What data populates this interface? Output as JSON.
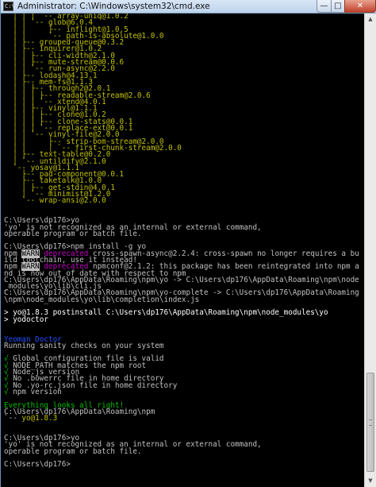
{
  "window": {
    "title": "Administrator: C:\\Windows\\system32\\cmd.exe",
    "icon_label": "C:\\",
    "minimize_glyph": "—",
    "maximize_glyph": "□",
    "close_glyph": "✕"
  },
  "colors": {
    "default": "#c0c0c0",
    "yellow": "#c0c000",
    "white": "#ffffff",
    "blue": "#2050ff",
    "green": "#00c000",
    "warn_bg": "#c0c0c0",
    "warn_fg": "#000000",
    "magenta": "#c000c0"
  },
  "console": {
    "lines": [
      [
        {
          "t": "  │ │ │ `-- ",
          "c": "yellow"
        },
        {
          "t": "array-uniq@1.0.2",
          "c": "yellow"
        }
      ],
      [
        {
          "t": "  │ │ `-- glob@6.0.4",
          "c": "yellow"
        }
      ],
      [
        {
          "t": "  │ │     ├-- inflight@1.0.5",
          "c": "yellow"
        }
      ],
      [
        {
          "t": "  │ │     `-- path-is-absolute@1.0.0",
          "c": "yellow"
        }
      ],
      [
        {
          "t": "  │ ├-- grouped-queue@0.3.2",
          "c": "yellow"
        }
      ],
      [
        {
          "t": "  │ ├-- inquirer@1.0.2",
          "c": "yellow"
        }
      ],
      [
        {
          "t": "  │ │ ├-- cli-width@2.1.0",
          "c": "yellow"
        }
      ],
      [
        {
          "t": "  │ │ ├-- mute-stream@0.0.6",
          "c": "yellow"
        }
      ],
      [
        {
          "t": "  │ │ `-- run-async@2.2.0",
          "c": "yellow"
        }
      ],
      [
        {
          "t": "  │ ├-- lodash@4.13.1",
          "c": "yellow"
        }
      ],
      [
        {
          "t": "  │ ├-- mem-fs@1.1.3",
          "c": "yellow"
        }
      ],
      [
        {
          "t": "  │ │ ├-- through2@2.0.1",
          "c": "yellow"
        }
      ],
      [
        {
          "t": "  │ │ │ ├-- readable-stream@2.0.6",
          "c": "yellow"
        }
      ],
      [
        {
          "t": "  │ │ │ `-- xtend@4.0.1",
          "c": "yellow"
        }
      ],
      [
        {
          "t": "  │ │ ├-- vinyl@1.1.1",
          "c": "yellow"
        }
      ],
      [
        {
          "t": "  │ │ │ ├-- clone@1.0.2",
          "c": "yellow"
        }
      ],
      [
        {
          "t": "  │ │ │ ├-- clone-stats@0.0.1",
          "c": "yellow"
        }
      ],
      [
        {
          "t": "  │ │ │ `-- replace-ext@0.0.1",
          "c": "yellow"
        }
      ],
      [
        {
          "t": "  │ │ `-- vinyl-file@2.0.0",
          "c": "yellow"
        }
      ],
      [
        {
          "t": "  │ │     ├-- strip-bom-stream@2.0.0",
          "c": "yellow"
        }
      ],
      [
        {
          "t": "  │ │     │ `-- first-chunk-stream@2.0.0",
          "c": "yellow"
        }
      ],
      [
        {
          "t": "  │ ├-- text-table@0.2.0",
          "c": "yellow"
        }
      ],
      [
        {
          "t": "  │ `-- untildify@2.1.0",
          "c": "yellow"
        }
      ],
      [
        {
          "t": "  `-- yosay@1.1.1",
          "c": "yellow"
        }
      ],
      [
        {
          "t": "    ├-- pad-component@0.0.1",
          "c": "yellow"
        }
      ],
      [
        {
          "t": "    ├-- taketalk@1.0.0",
          "c": "yellow"
        }
      ],
      [
        {
          "t": "    │ ├-- get-stdin@4.0.1",
          "c": "yellow"
        }
      ],
      [
        {
          "t": "    │ `-- minimist@1.2.0",
          "c": "yellow"
        }
      ],
      [
        {
          "t": "    `-- wrap-ansi@2.0.0",
          "c": "yellow"
        }
      ],
      [
        {
          "t": " ",
          "c": "default"
        }
      ],
      [
        {
          "t": " ",
          "c": "default"
        }
      ],
      [
        {
          "t": "C:\\Users\\dp176>yo",
          "c": "default"
        }
      ],
      [
        {
          "t": "'yo' is not recognized as an internal or external command,",
          "c": "default"
        }
      ],
      [
        {
          "t": "operable program or batch file.",
          "c": "default"
        }
      ],
      [
        {
          "t": " ",
          "c": "default"
        }
      ],
      [
        {
          "t": "C:\\Users\\dp176>npm install -g yo",
          "c": "default"
        }
      ],
      [
        {
          "t": "npm ",
          "c": "default"
        },
        {
          "t": "WARN",
          "c": "warn"
        },
        {
          "t": " ",
          "c": "default"
        },
        {
          "t": "deprecated",
          "c": "magenta"
        },
        {
          "t": " cross-spawn-async@2.2.4: cross-spawn no longer requires a bu",
          "c": "default"
        }
      ],
      [
        {
          "t": "ild toolchain, use it instead!",
          "c": "default"
        }
      ],
      [
        {
          "t": "npm ",
          "c": "default"
        },
        {
          "t": "WARN",
          "c": "warn"
        },
        {
          "t": " ",
          "c": "default"
        },
        {
          "t": "deprecated",
          "c": "magenta"
        },
        {
          "t": " npmconf@2.1.2: this package has been reintegrated into npm a",
          "c": "default"
        }
      ],
      [
        {
          "t": "nd is now out of date with respect to npm",
          "c": "default"
        }
      ],
      [
        {
          "t": "C:\\Users\\dp176\\AppData\\Roaming\\npm\\yo -> C:\\Users\\dp176\\AppData\\Roaming\\npm\\node",
          "c": "default"
        }
      ],
      [
        {
          "t": "_modules\\yo\\lib\\cli.js",
          "c": "default"
        }
      ],
      [
        {
          "t": "C:\\Users\\dp176\\AppData\\Roaming\\npm\\yo-complete -> C:\\Users\\dp176\\AppData\\Roaming",
          "c": "default"
        }
      ],
      [
        {
          "t": "\\npm\\node_modules\\yo\\lib\\completion\\index.js",
          "c": "default"
        }
      ],
      [
        {
          "t": " ",
          "c": "default"
        }
      ],
      [
        {
          "t": "> yo@1.8.3 postinstall C:\\Users\\dp176\\AppData\\Roaming\\npm\\node_modules\\yo",
          "c": "white"
        }
      ],
      [
        {
          "t": "> yodoctor",
          "c": "white"
        }
      ],
      [
        {
          "t": " ",
          "c": "default"
        }
      ],
      [
        {
          "t": " ",
          "c": "default"
        }
      ],
      [
        {
          "t": "Yeoman Doctor",
          "c": "blue"
        }
      ],
      [
        {
          "t": "Running sanity checks on your system",
          "c": "default"
        }
      ],
      [
        {
          "t": " ",
          "c": "default"
        }
      ],
      [
        {
          "t": "√",
          "c": "green"
        },
        {
          "t": " Global configuration file is valid",
          "c": "default"
        }
      ],
      [
        {
          "t": "√",
          "c": "green"
        },
        {
          "t": " NODE_PATH matches the npm root",
          "c": "default"
        }
      ],
      [
        {
          "t": "√",
          "c": "green"
        },
        {
          "t": " Node.js version",
          "c": "default"
        }
      ],
      [
        {
          "t": "√",
          "c": "green"
        },
        {
          "t": " No .bowerrc file in home directory",
          "c": "default"
        }
      ],
      [
        {
          "t": "√",
          "c": "green"
        },
        {
          "t": " No .yo-rc.json file in home directory",
          "c": "default"
        }
      ],
      [
        {
          "t": "√",
          "c": "green"
        },
        {
          "t": " npm version",
          "c": "default"
        }
      ],
      [
        {
          "t": " ",
          "c": "default"
        }
      ],
      [
        {
          "t": "Everything looks all right!",
          "c": "green"
        }
      ],
      [
        {
          "t": "C:\\Users\\dp176\\AppData\\Roaming\\npm",
          "c": "default"
        }
      ],
      [
        {
          "t": "`-- ",
          "c": "default"
        },
        {
          "t": "yo@1.8.3",
          "c": "yellow"
        }
      ],
      [
        {
          "t": " ",
          "c": "default"
        }
      ],
      [
        {
          "t": " ",
          "c": "default"
        }
      ],
      [
        {
          "t": "C:\\Users\\dp176>yo",
          "c": "default"
        }
      ],
      [
        {
          "t": "'yo' is not recognized as an internal or external command,",
          "c": "default"
        }
      ],
      [
        {
          "t": "operable program or batch file.",
          "c": "default"
        }
      ],
      [
        {
          "t": " ",
          "c": "default"
        }
      ],
      [
        {
          "t": "C:\\Users\\dp176>",
          "c": "default"
        }
      ]
    ]
  },
  "scrollbar": {
    "up_glyph": "▲",
    "down_glyph": "▼"
  }
}
